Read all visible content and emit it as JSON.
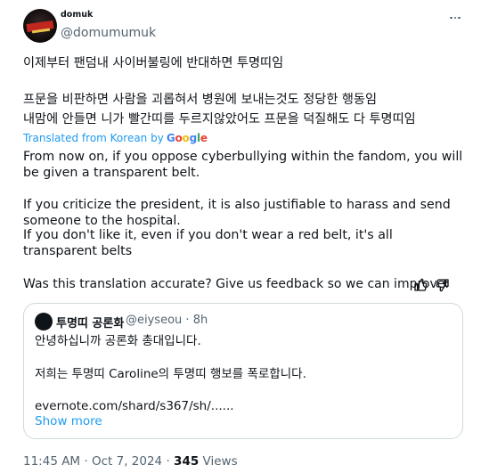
{
  "tweet": {
    "display_name": "domuk",
    "handle": "@domumumuk",
    "original_lines": [
      "이제부터 팬덤내 사이버불링에 반대하면 투명띠임",
      "프문을 비판하면 사람을 괴롭혀서 병원에 보내는것도 정당한 행동임",
      "내맘에 안들면 니가 빨간띠를 두르지않았어도 프문을 덕질해도 다 투명띠임"
    ],
    "translated_from": "Translated from Korean by",
    "google_letters": [
      "G",
      "o",
      "o",
      "g",
      "l",
      "e"
    ],
    "translation_lines": [
      "From now on, if you oppose cyberbullying within the fandom, you will be given a transparent belt.",
      "If you criticize the president, it is also justifiable to harass and send someone to the hospital.",
      "If you don't like it, even if you don't wear a red belt, it's all transparent belts"
    ],
    "feedback_prompt": "Was this translation accurate? Give us feedback so we can improve:",
    "time": "11:45 AM",
    "date": "Oct 7, 2024",
    "separator": "·",
    "views_count": "345",
    "views_label": "Views"
  },
  "quoted": {
    "name": "투명띠 공론화",
    "handle": "@eiyseou",
    "separator": "·",
    "time": "8h",
    "lines": [
      "안녕하십니까 공론화 총대입니다.",
      "저희는 투명띠 Caroline의 투명띠 행보를 폭로합니다.",
      "evernote.com/shard/s367/sh/......"
    ],
    "show_more": "Show more"
  },
  "colors": {
    "link": "#1d9bf0",
    "text": "#0f1419",
    "secondary": "#536471",
    "border": "#cfd9de"
  },
  "icons": [
    "more-icon",
    "thumbs-up-icon",
    "thumbs-down-icon"
  ]
}
